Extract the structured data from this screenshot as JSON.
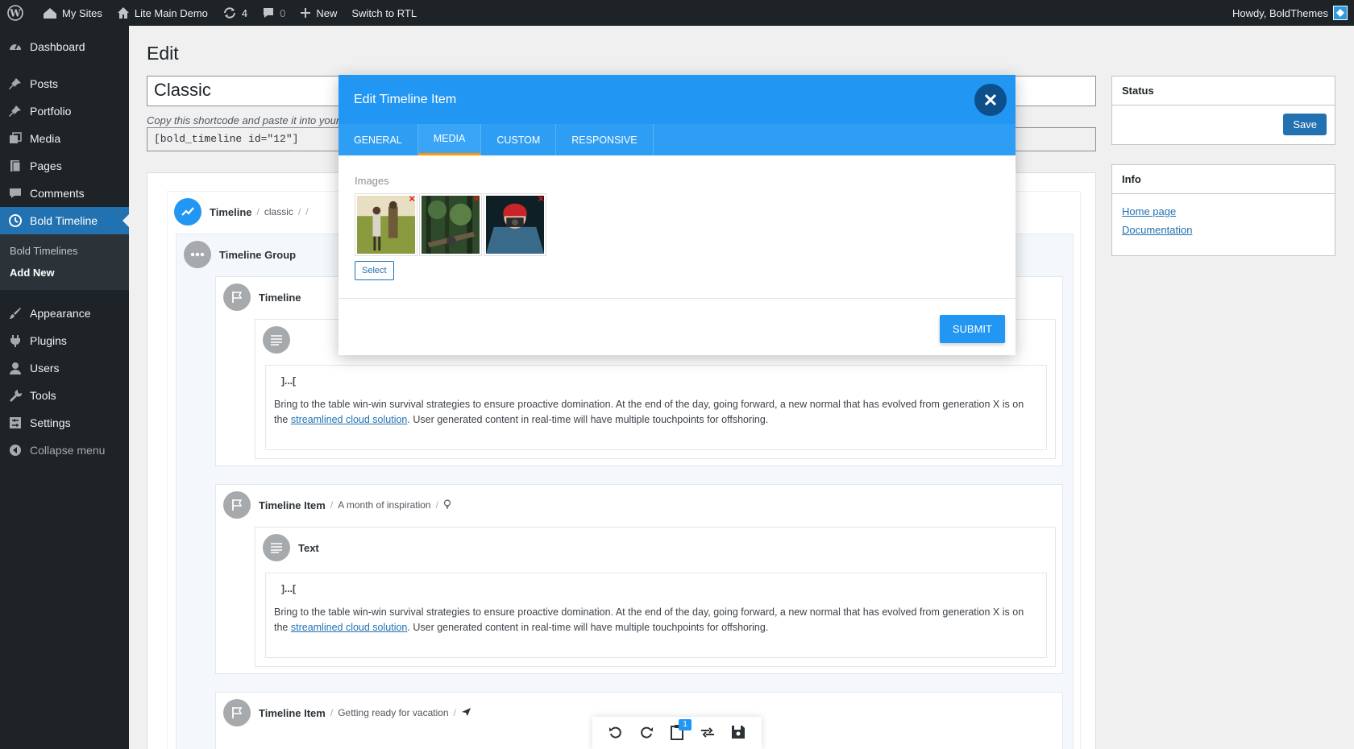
{
  "adminbar": {
    "my_sites": "My Sites",
    "site_name": "Lite Main Demo",
    "updates_count": "4",
    "comments_count": "0",
    "new_label": "New",
    "switch_rtl": "Switch to RTL",
    "howdy": "Howdy, BoldThemes"
  },
  "sidebar": {
    "items": [
      {
        "label": "Dashboard",
        "icon": "dashboard-icon"
      },
      {
        "label": "Posts",
        "icon": "pin-icon"
      },
      {
        "label": "Portfolio",
        "icon": "pin-icon"
      },
      {
        "label": "Media",
        "icon": "media-icon"
      },
      {
        "label": "Pages",
        "icon": "pages-icon"
      },
      {
        "label": "Comments",
        "icon": "comment-icon"
      },
      {
        "label": "Bold Timeline",
        "icon": "clock-icon"
      },
      {
        "label": "Appearance",
        "icon": "brush-icon"
      },
      {
        "label": "Plugins",
        "icon": "plugin-icon"
      },
      {
        "label": "Users",
        "icon": "user-icon"
      },
      {
        "label": "Tools",
        "icon": "wrench-icon"
      },
      {
        "label": "Settings",
        "icon": "settings-icon"
      }
    ],
    "submenu": [
      "Bold Timelines",
      "Add New"
    ],
    "collapse": "Collapse menu"
  },
  "main": {
    "title": "Edit",
    "post_title": "Classic",
    "hint": "Copy this shortcode and paste it into your",
    "shortcode": "[bold_timeline id=\"12\"]"
  },
  "timeline": {
    "root_label": "Timeline",
    "root_meta": "classic",
    "group_label": "Timeline Group",
    "item1_label": "Timeline",
    "item2_label": "Timeline Item",
    "item2_meta": "A month of inspiration",
    "item3_label": "Timeline Item",
    "item3_meta": "Getting ready for vacation",
    "text_label": "Text",
    "code": "]...[",
    "para_start": "Bring to the table win-win survival strategies to ensure proactive domination. At the end of the day, going forward, a new normal that has evolved from generation X is on the ",
    "para_link": "streamlined cloud solution",
    "para_end": ". User generated content in real-time will have multiple touchpoints for offshoring."
  },
  "right": {
    "status_title": "Status",
    "save_label": "Save",
    "info_title": "Info",
    "home_link": "Home page",
    "doc_link": "Documentation"
  },
  "modal": {
    "title": "Edit Timeline Item",
    "tabs": [
      "GENERAL",
      "MEDIA",
      "CUSTOM",
      "RESPONSIVE"
    ],
    "active_tab": "MEDIA",
    "images_label": "Images",
    "select_label": "Select",
    "submit_label": "SUBMIT",
    "remove_mark": "×"
  },
  "toolbar": {
    "badge": "1"
  }
}
